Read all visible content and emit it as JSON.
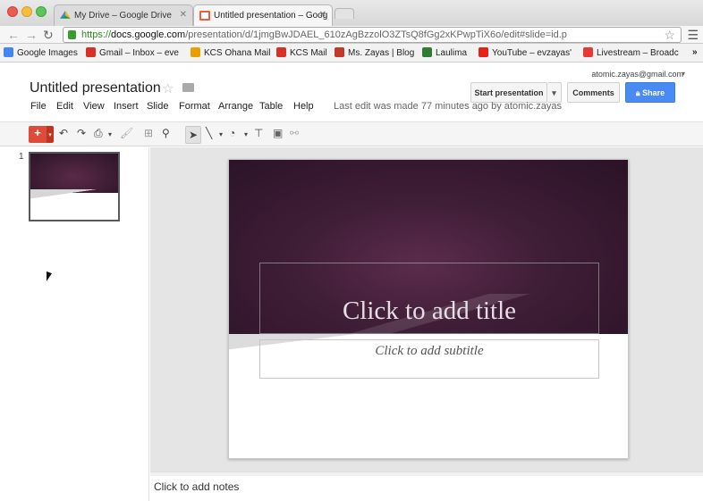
{
  "browser": {
    "tabs": [
      {
        "label": "My Drive – Google Drive",
        "icon": "google-drive-icon"
      },
      {
        "label": "Untitled presentation – Goog",
        "icon": "google-slides-icon"
      }
    ],
    "url_scheme": "https://",
    "url_host": "docs.google.com",
    "url_path": "/presentation/d/1jmgBwJDAEL_610zAgBzzolO3ZTsQ8fGg2xKPwpTiX6o/edit#slide=id.p",
    "bookmarks": [
      {
        "label": "Google Images",
        "color": "#4285f4"
      },
      {
        "label": "Gmail – Inbox – eve",
        "color": "#d93025"
      },
      {
        "label": "KCS Ohana Mail",
        "color": "#e8a000"
      },
      {
        "label": "KCS Mail",
        "color": "#d93025"
      },
      {
        "label": "Ms. Zayas | Blog",
        "color": "#c0392b"
      },
      {
        "label": "Laulima",
        "color": "#2e7d32"
      },
      {
        "label": "YouTube – evzayas'",
        "color": "#e62117"
      },
      {
        "label": "Livestream – Broadc",
        "color": "#e53935"
      }
    ]
  },
  "header": {
    "title": "Untitled presentation",
    "account": "atomic.zayas@gmail.com",
    "start_presentation": "Start presentation",
    "comments": "Comments",
    "share": "Share",
    "last_edit": "Last edit was made 77 minutes ago by atomic.zayas"
  },
  "menu": [
    "File",
    "Edit",
    "View",
    "Insert",
    "Slide",
    "Format",
    "Arrange",
    "Table",
    "Help"
  ],
  "filmstrip": {
    "slide_number": "1"
  },
  "slide": {
    "title_placeholder": "Click to add title",
    "subtitle_placeholder": "Click to add subtitle"
  },
  "notes": {
    "placeholder": "Click to add notes"
  },
  "colors": {
    "accent_red": "#dd4b39",
    "share_blue": "#4a8af4",
    "theme_plum": "#3e1d36"
  }
}
